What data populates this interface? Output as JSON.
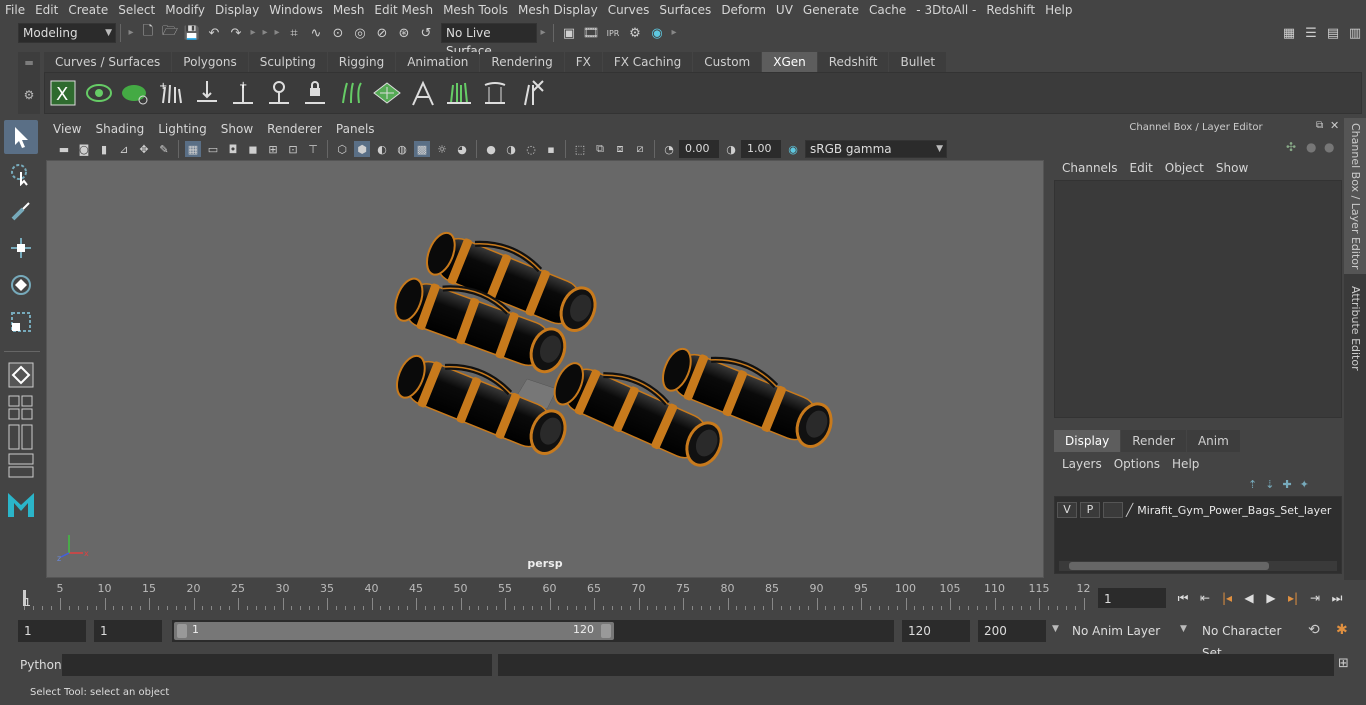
{
  "menubar": {
    "items": [
      "File",
      "Edit",
      "Create",
      "Select",
      "Modify",
      "Display",
      "Windows",
      "Mesh",
      "Edit Mesh",
      "Mesh Tools",
      "Mesh Display",
      "Curves",
      "Surfaces",
      "Deform",
      "UV",
      "Generate",
      "Cache",
      "- 3DtoAll -",
      "Redshift",
      "Help"
    ]
  },
  "statusline": {
    "mode": "Modeling",
    "live_surface": "No Live Surface"
  },
  "shelf": {
    "tabs": [
      "Curves / Surfaces",
      "Polygons",
      "Sculpting",
      "Rigging",
      "Animation",
      "Rendering",
      "FX",
      "FX Caching",
      "Custom",
      "XGen",
      "Redshift",
      "Bullet"
    ],
    "active_tab": "XGen"
  },
  "viewport": {
    "menu": [
      "View",
      "Shading",
      "Lighting",
      "Show",
      "Renderer",
      "Panels"
    ],
    "exposure": "0.00",
    "gamma": "1.00",
    "color_space": "sRGB gamma",
    "camera": "persp"
  },
  "channel_box": {
    "title": "Channel Box / Layer Editor",
    "menu": [
      "Channels",
      "Edit",
      "Object",
      "Show"
    ]
  },
  "layer_editor": {
    "tabs": [
      "Display",
      "Render",
      "Anim"
    ],
    "active_tab": "Display",
    "menu": [
      "Layers",
      "Options",
      "Help"
    ],
    "layer": {
      "v": "V",
      "p": "P",
      "name": "Mirafit_Gym_Power_Bags_Set_layer"
    }
  },
  "side_tabs": [
    "Channel Box / Layer Editor",
    "Attribute Editor"
  ],
  "timeslider": {
    "ticks": [
      "5",
      "10",
      "15",
      "20",
      "25",
      "30",
      "35",
      "40",
      "45",
      "50",
      "55",
      "60",
      "65",
      "70",
      "75",
      "80",
      "85",
      "90",
      "95",
      "100",
      "105",
      "110",
      "115",
      "12"
    ],
    "start_marker": "1",
    "current_frame": "1"
  },
  "range": {
    "start": "1",
    "playback_start": "1",
    "range_start_label": "1",
    "range_end_label": "120",
    "playback_end": "120",
    "end": "200",
    "anim_layer": "No Anim Layer",
    "character_set": "No Character Set"
  },
  "command": {
    "language": "Python"
  },
  "help_line": "Select Tool: select an object",
  "colors": {
    "accent": "#5a6f86",
    "bag_body": "#0a0a0a",
    "bag_strap": "#c87a1c",
    "viewport_bg": "#686868"
  }
}
